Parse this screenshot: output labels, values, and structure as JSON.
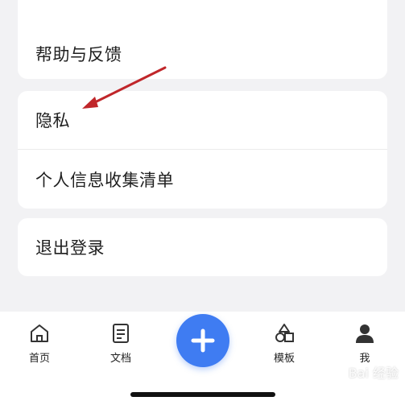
{
  "settings": {
    "items": {
      "help_feedback": "帮助与反馈",
      "privacy": "隐私",
      "personal_info_list": "个人信息收集清单",
      "logout": "退出登录"
    }
  },
  "annotation": {
    "arrow_color": "#c0262a"
  },
  "tabbar": {
    "tabs": [
      {
        "label": "首页",
        "icon": "home-icon"
      },
      {
        "label": "文档",
        "icon": "document-icon"
      },
      {
        "label": "",
        "icon": "plus-icon"
      },
      {
        "label": "模板",
        "icon": "template-icon"
      },
      {
        "label": "我",
        "icon": "person-icon"
      }
    ],
    "fab_color": "#3f7cf2"
  },
  "watermark": "Bai 经验"
}
